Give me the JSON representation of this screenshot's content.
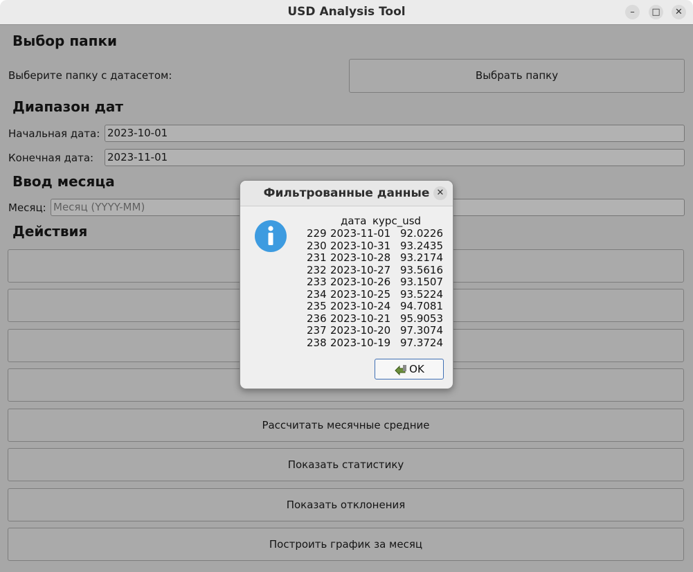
{
  "window": {
    "title": "USD Analysis Tool"
  },
  "folder_section": {
    "title": "Выбор папки",
    "label": "Выберите папку с датасетом:",
    "button": "Выбрать папку"
  },
  "dates_section": {
    "title": "Диапазон дат",
    "start_label": "Начальная дата:",
    "start_value": "2023-10-01",
    "end_label": "Конечная дата:",
    "end_value": "2023-11-01"
  },
  "month_section": {
    "title": "Ввод месяца",
    "label": "Месяц:",
    "placeholder": "Месяц (YYYY-MM)"
  },
  "actions_section": {
    "title": "Действия",
    "buttons": [
      "",
      "",
      "",
      "",
      "Рассчитать месячные средние",
      "Показать статистику",
      "Показать отклонения",
      "Построить график за месяц"
    ]
  },
  "dialog": {
    "title": "Фильтрованные данные",
    "icon": "info-icon",
    "columns": [
      "дата",
      "курс_usd"
    ],
    "rows": [
      {
        "idx": "229",
        "date": "2023-11-01",
        "rate": "92.0226"
      },
      {
        "idx": "230",
        "date": "2023-10-31",
        "rate": "93.2435"
      },
      {
        "idx": "231",
        "date": "2023-10-28",
        "rate": "93.2174"
      },
      {
        "idx": "232",
        "date": "2023-10-27",
        "rate": "93.5616"
      },
      {
        "idx": "233",
        "date": "2023-10-26",
        "rate": "93.1507"
      },
      {
        "idx": "234",
        "date": "2023-10-25",
        "rate": "93.5224"
      },
      {
        "idx": "235",
        "date": "2023-10-24",
        "rate": "94.7081"
      },
      {
        "idx": "236",
        "date": "2023-10-21",
        "rate": "95.9053"
      },
      {
        "idx": "237",
        "date": "2023-10-20",
        "rate": "97.3074"
      },
      {
        "idx": "238",
        "date": "2023-10-19",
        "rate": "97.3724"
      }
    ],
    "ok_label": "OK"
  },
  "colors": {
    "info_icon": "#3d9be0",
    "ok_border": "#3f6fb4"
  }
}
